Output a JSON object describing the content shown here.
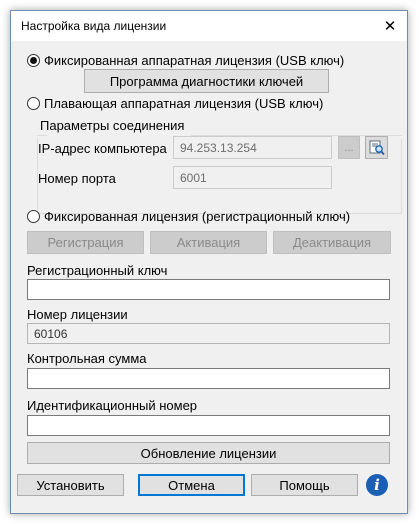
{
  "window": {
    "title": "Настройка вида лицензии",
    "close_symbol": "✕"
  },
  "license_type": {
    "fixed_hw_label": "Фиксированная аппаратная лицензия (USB ключ)",
    "fixed_hw_selected": true,
    "diagnostics_button": "Программа диагностики ключей",
    "floating_hw_label": "Плавающая аппаратная лицензия (USB ключ)",
    "floating_hw_selected": false,
    "fixed_reg_label": "Фиксированная лицензия (регистрационный ключ)",
    "fixed_reg_selected": false
  },
  "connection": {
    "group_title": "Параметры соединения",
    "ip_label": "IP-адрес компьютера",
    "ip_value": "94.253.13.254",
    "browse_label": "...",
    "search_icon": "search-computer-icon",
    "port_label": "Номер порта",
    "port_value": "6001"
  },
  "reg_buttons": {
    "register": "Регистрация",
    "activate": "Активация",
    "deactivate": "Деактивация"
  },
  "fields": {
    "reg_key_label": "Регистрационный ключ",
    "reg_key_value": "",
    "license_number_label": "Номер лицензии",
    "license_number_value": "60106",
    "checksum_label": "Контрольная сумма",
    "checksum_value": "",
    "id_number_label": "Идентификационный номер",
    "id_number_value": ""
  },
  "update_button": "Обновление лицензии",
  "footer": {
    "install": "Установить",
    "cancel": "Отмена",
    "help": "Помощь",
    "info_icon": "info-icon",
    "info_glyph": "i"
  },
  "colors": {
    "accent": "#0078d7",
    "info": "#1a5fb4"
  }
}
